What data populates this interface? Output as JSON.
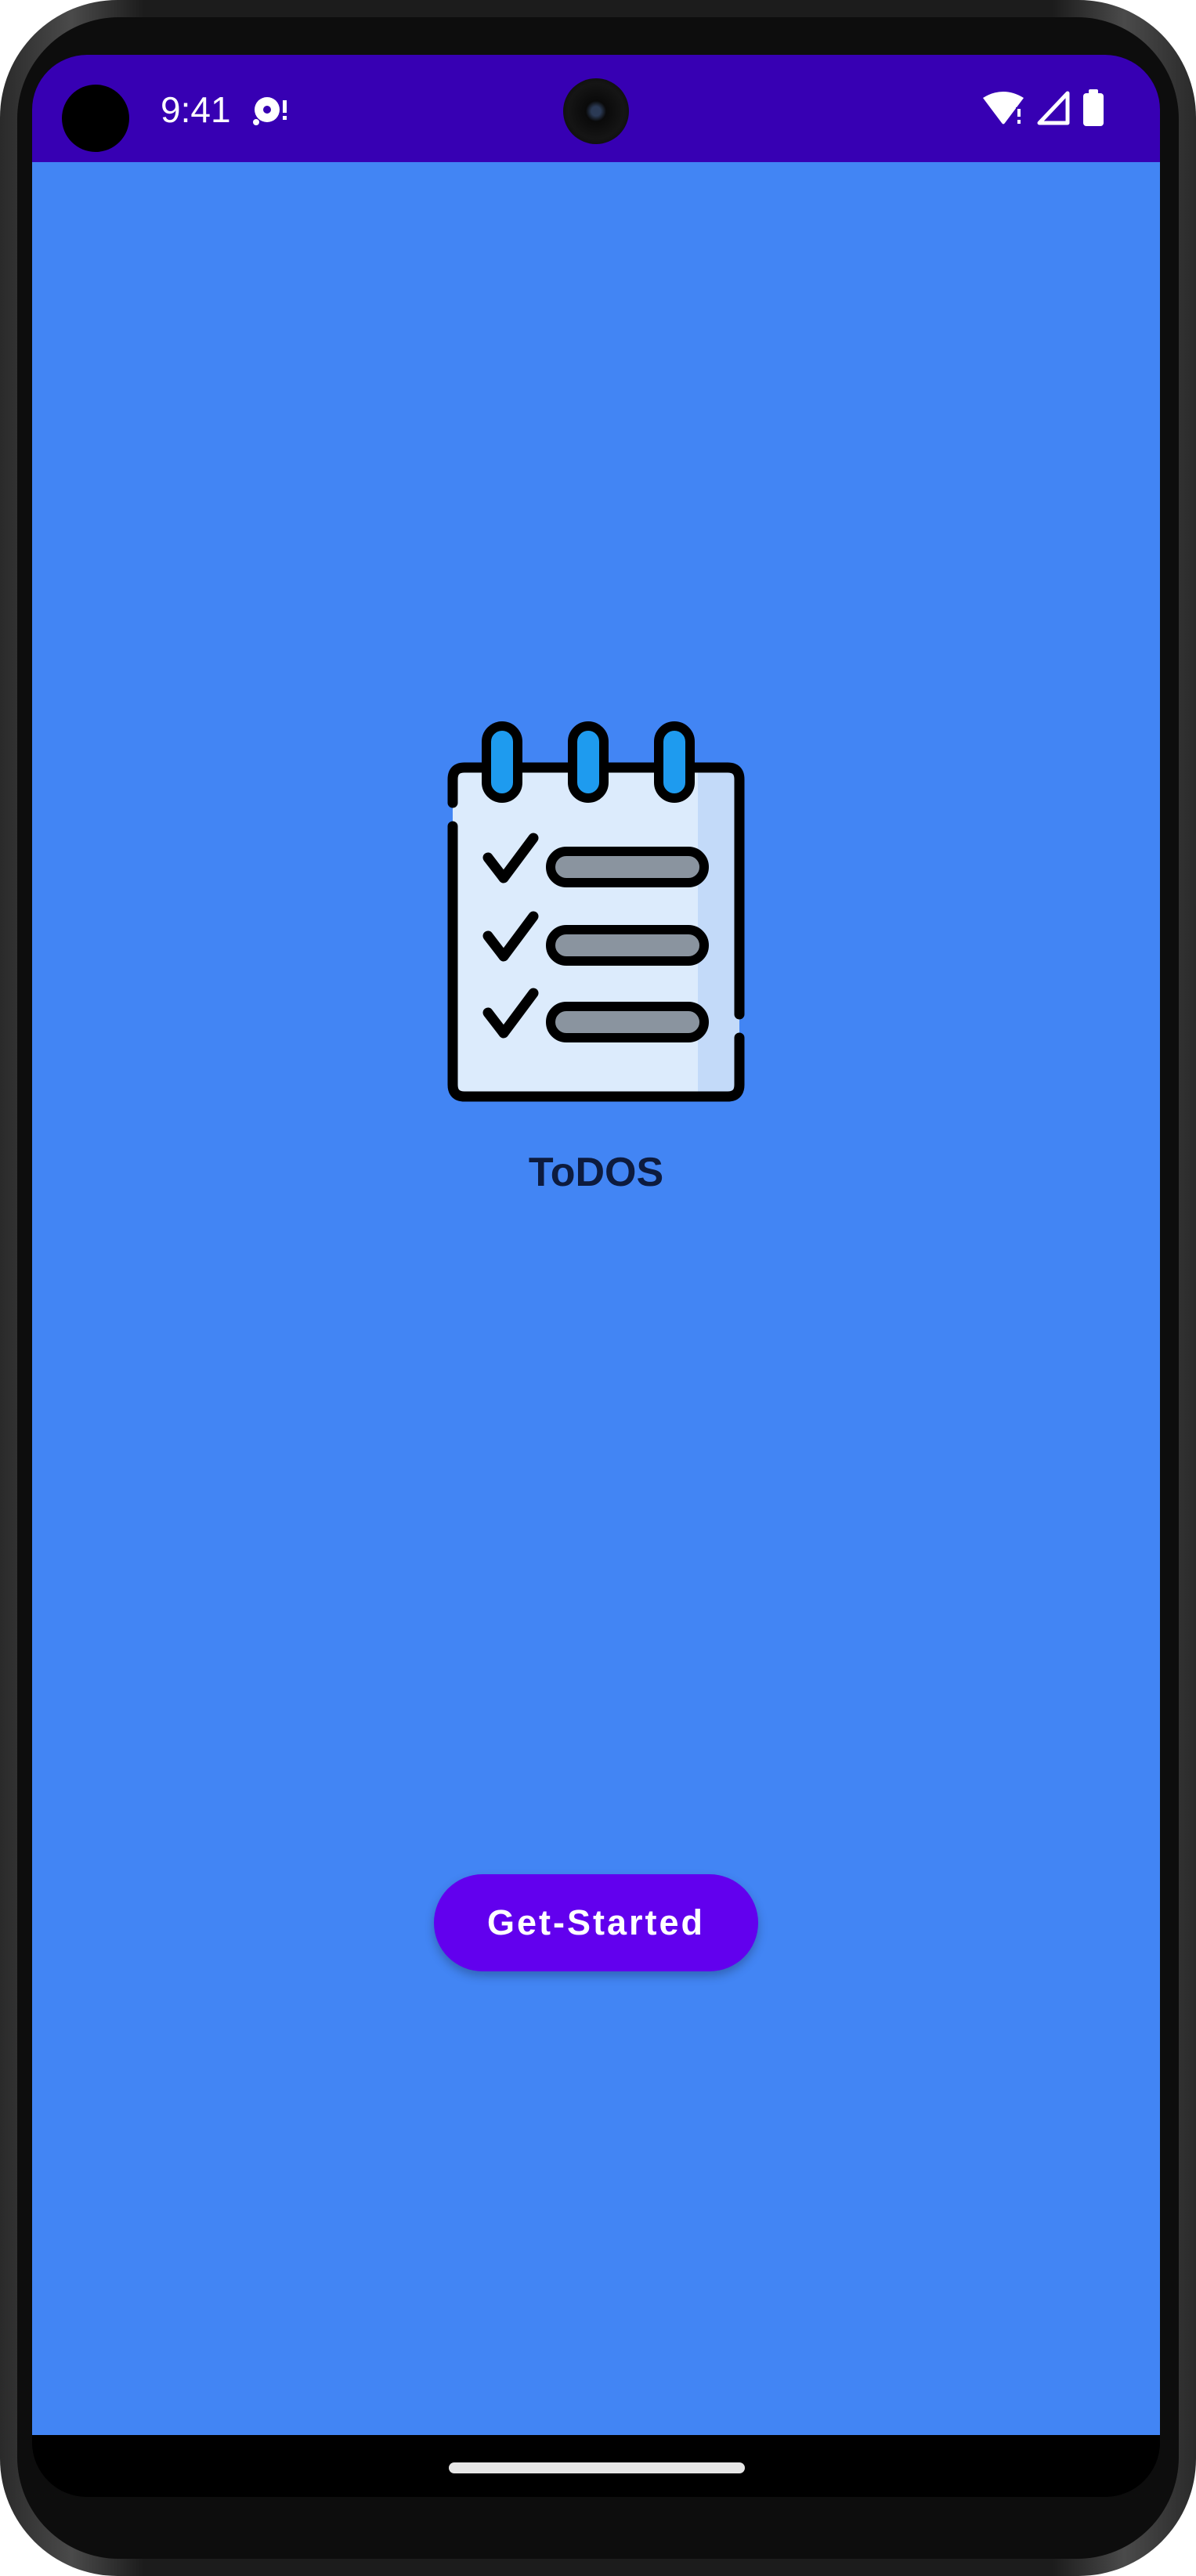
{
  "status_bar": {
    "time": "9:41",
    "background_color": "#3700b3",
    "icons": [
      "media-notification-icon",
      "wifi-icon",
      "cellular-signal-icon",
      "battery-icon"
    ]
  },
  "app": {
    "background_color": "#4285f4",
    "logo_icon": "checklist-notepad-icon",
    "title": "ToDOS",
    "get_started_label": "Get-Started",
    "button_color": "#6200ee"
  },
  "nav_bar": {
    "gesture": "home-handle"
  }
}
